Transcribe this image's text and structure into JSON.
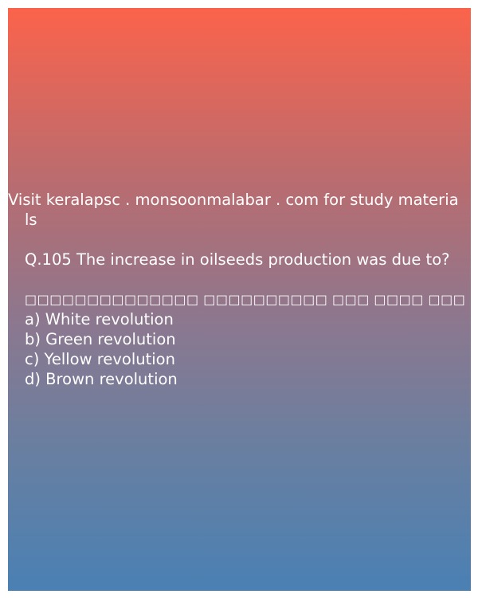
{
  "promo": {
    "line1": "Visit keralapsc . monsoonmalabar . com for study materia",
    "line2": "ls"
  },
  "question": {
    "english": "Q.105 The increase in oilseeds production was due to?",
    "malayalam": "□□□□□□□□□□□□□□ □□□□□□□□□□ □□□ □□□□ □□□ ,□□□□ –?"
  },
  "options": [
    "a) White revolution",
    "b) Green revolution",
    "c) Yellow revolution",
    "d) Brown revolution"
  ]
}
